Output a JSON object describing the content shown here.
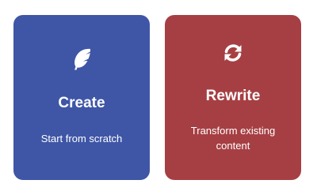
{
  "cards": [
    {
      "id": "create",
      "title": "Create",
      "description": "Start from scratch",
      "icon": "feather-icon",
      "color": "#3f56a6"
    },
    {
      "id": "rewrite",
      "title": "Rewrite",
      "description": "Transform existing content",
      "icon": "sync-icon",
      "color": "#a63f43"
    }
  ]
}
